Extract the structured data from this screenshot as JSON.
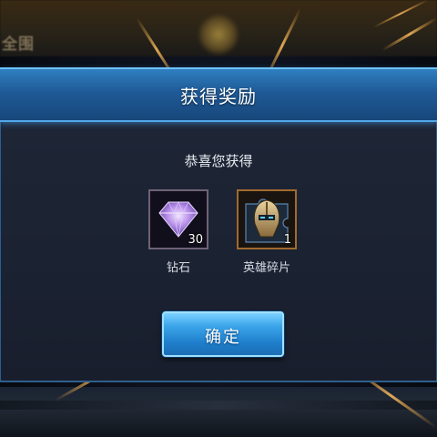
{
  "background": {
    "top_text": "全围"
  },
  "dialog": {
    "title": "获得奖励",
    "congrats": "恭喜您获得",
    "rewards": [
      {
        "name": "钻石",
        "count": "30",
        "icon": "diamond-icon",
        "frame_color": "#6e6276"
      },
      {
        "name": "英雄碎片",
        "count": "1",
        "icon": "hero-shard-icon",
        "frame_color": "#a06a2e"
      }
    ],
    "confirm_label": "确定"
  },
  "colors": {
    "header_blue": "#1f5a96",
    "button_blue": "#1f7fcc",
    "panel_bg": "#1b2232"
  }
}
